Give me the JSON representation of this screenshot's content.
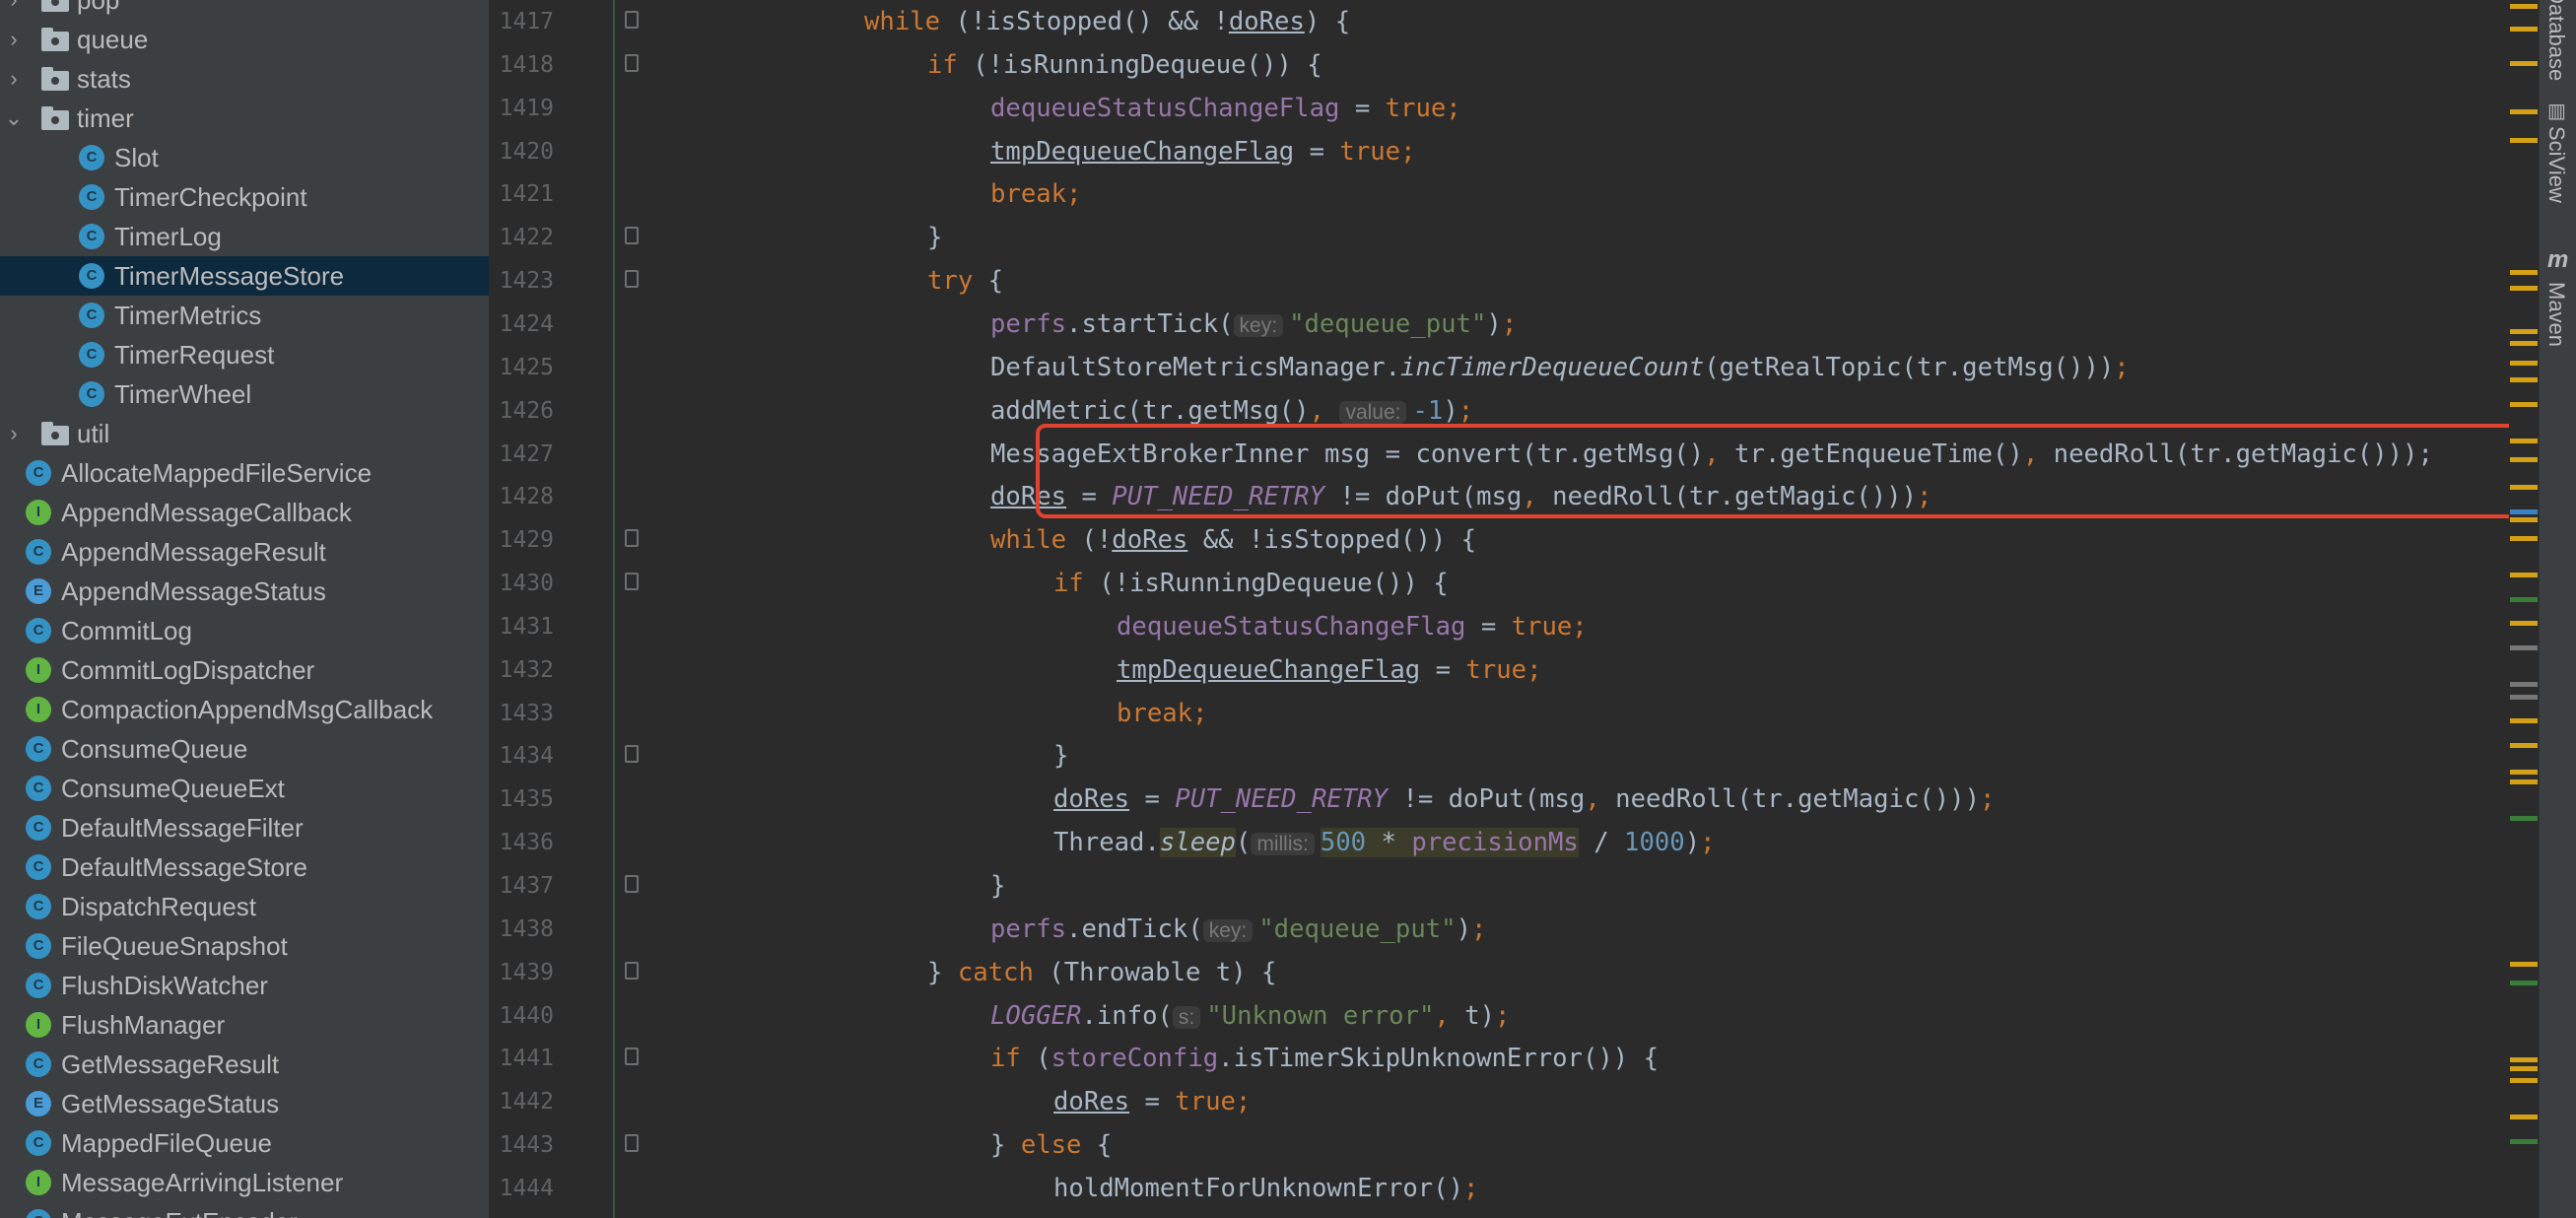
{
  "project_tree": {
    "items": [
      {
        "type": "folder",
        "label": "pop",
        "expanded": false,
        "indent": 1
      },
      {
        "type": "folder",
        "label": "queue",
        "expanded": false,
        "indent": 1
      },
      {
        "type": "folder",
        "label": "stats",
        "expanded": false,
        "indent": 1
      },
      {
        "type": "folder",
        "label": "timer",
        "expanded": true,
        "indent": 1
      },
      {
        "type": "class",
        "label": "Slot",
        "indent": 2
      },
      {
        "type": "class",
        "label": "TimerCheckpoint",
        "indent": 2
      },
      {
        "type": "class",
        "label": "TimerLog",
        "indent": 2
      },
      {
        "type": "class",
        "label": "TimerMessageStore",
        "indent": 2,
        "selected": true
      },
      {
        "type": "class",
        "label": "TimerMetrics",
        "indent": 2
      },
      {
        "type": "class",
        "label": "TimerRequest",
        "indent": 2
      },
      {
        "type": "class",
        "label": "TimerWheel",
        "indent": 2
      },
      {
        "type": "folder",
        "label": "util",
        "expanded": false,
        "indent": 1
      },
      {
        "type": "class",
        "label": "AllocateMappedFileService",
        "indent": 1
      },
      {
        "type": "interface",
        "label": "AppendMessageCallback",
        "indent": 1
      },
      {
        "type": "class",
        "label": "AppendMessageResult",
        "indent": 1
      },
      {
        "type": "enum",
        "label": "AppendMessageStatus",
        "indent": 1
      },
      {
        "type": "class",
        "label": "CommitLog",
        "indent": 1
      },
      {
        "type": "interface",
        "label": "CommitLogDispatcher",
        "indent": 1
      },
      {
        "type": "interface",
        "label": "CompactionAppendMsgCallback",
        "indent": 1
      },
      {
        "type": "class",
        "label": "ConsumeQueue",
        "indent": 1
      },
      {
        "type": "class",
        "label": "ConsumeQueueExt",
        "indent": 1
      },
      {
        "type": "class",
        "label": "DefaultMessageFilter",
        "indent": 1
      },
      {
        "type": "class",
        "label": "DefaultMessageStore",
        "indent": 1
      },
      {
        "type": "class",
        "label": "DispatchRequest",
        "indent": 1
      },
      {
        "type": "class",
        "label": "FileQueueSnapshot",
        "indent": 1
      },
      {
        "type": "class",
        "label": "FlushDiskWatcher",
        "indent": 1
      },
      {
        "type": "interface",
        "label": "FlushManager",
        "indent": 1
      },
      {
        "type": "class",
        "label": "GetMessageResult",
        "indent": 1
      },
      {
        "type": "enum",
        "label": "GetMessageStatus",
        "indent": 1
      },
      {
        "type": "class",
        "label": "MappedFileQueue",
        "indent": 1
      },
      {
        "type": "interface",
        "label": "MessageArrivingListener",
        "indent": 1
      },
      {
        "type": "class",
        "label": "MessageExtEncoder",
        "indent": 1
      }
    ],
    "badge_letters": {
      "class": "C",
      "interface": "I",
      "enum": "E"
    }
  },
  "editor": {
    "lines": [
      {
        "n": "1417",
        "indent": 5,
        "fold": true,
        "tokens": [
          [
            "kw",
            "while"
          ],
          [
            "p",
            " (!isStopped() && !"
          ],
          [
            "u",
            "doRes"
          ],
          [
            "p",
            ") {"
          ]
        ]
      },
      {
        "n": "1418",
        "indent": 6,
        "fold": true,
        "tokens": [
          [
            "kw",
            "if"
          ],
          [
            "p",
            " (!isRunningDequeue()) {"
          ]
        ]
      },
      {
        "n": "1419",
        "indent": 7,
        "tokens": [
          [
            "f",
            "dequeueStatusChangeFlag"
          ],
          [
            "p",
            " = "
          ],
          [
            "kw",
            "true"
          ],
          [
            "kw",
            ";"
          ]
        ]
      },
      {
        "n": "1420",
        "indent": 7,
        "tokens": [
          [
            "u",
            "tmpDequeueChangeFlag"
          ],
          [
            "p",
            " = "
          ],
          [
            "kw",
            "true"
          ],
          [
            "kw",
            ";"
          ]
        ]
      },
      {
        "n": "1421",
        "indent": 7,
        "tokens": [
          [
            "kw",
            "break;"
          ]
        ]
      },
      {
        "n": "1422",
        "indent": 6,
        "fold": true,
        "tokens": [
          [
            "p",
            "}"
          ]
        ]
      },
      {
        "n": "1423",
        "indent": 6,
        "fold": true,
        "tokens": [
          [
            "kw",
            "try"
          ],
          [
            "p",
            " {"
          ]
        ]
      },
      {
        "n": "1424",
        "indent": 7,
        "tokens": [
          [
            "f",
            "perfs"
          ],
          [
            "p",
            ".startTick("
          ],
          [
            "h",
            "key:"
          ],
          [
            "s",
            "\"dequeue_put\""
          ],
          [
            "p",
            ")"
          ],
          [
            "kw",
            ";"
          ]
        ]
      },
      {
        "n": "1425",
        "indent": 7,
        "tokens": [
          [
            "p",
            "DefaultStoreMetricsManager."
          ],
          [
            "st",
            "incTimerDequeueCount"
          ],
          [
            "p",
            "(getRealTopic(tr.getMsg()))"
          ],
          [
            "kw",
            ";"
          ]
        ]
      },
      {
        "n": "1426",
        "indent": 7,
        "tokens": [
          [
            "p",
            "addMetric(tr.getMsg()"
          ],
          [
            "kw",
            ","
          ],
          [
            "p",
            " "
          ],
          [
            "h",
            "value:"
          ],
          [
            "n",
            "-1"
          ],
          [
            "p",
            ")"
          ],
          [
            "kw",
            ";"
          ]
        ]
      },
      {
        "n": "1427",
        "indent": 7,
        "tokens": [
          [
            "p",
            "MessageExtBrokerInner msg = convert(tr.getMsg()"
          ],
          [
            "kw",
            ","
          ],
          [
            "p",
            " tr.getEnqueueTime()"
          ],
          [
            "kw",
            ","
          ],
          [
            "p",
            " needRoll(tr.getMagic()));"
          ]
        ]
      },
      {
        "n": "1428",
        "indent": 7,
        "tokens": [
          [
            "u",
            "doRes"
          ],
          [
            "p",
            " = "
          ],
          [
            "c",
            "PUT_NEED_RETRY"
          ],
          [
            "p",
            " != doPut(msg"
          ],
          [
            "kw",
            ","
          ],
          [
            "p",
            " needRoll(tr.getMagic()))"
          ],
          [
            "kw",
            ";"
          ]
        ]
      },
      {
        "n": "1429",
        "indent": 7,
        "fold": true,
        "tokens": [
          [
            "kw",
            "while"
          ],
          [
            "p",
            " (!"
          ],
          [
            "u",
            "doRes"
          ],
          [
            "p",
            " && !isStopped()) {"
          ]
        ]
      },
      {
        "n": "1430",
        "indent": 8,
        "fold": true,
        "tokens": [
          [
            "kw",
            "if"
          ],
          [
            "p",
            " (!isRunningDequeue()) {"
          ]
        ]
      },
      {
        "n": "1431",
        "indent": 9,
        "tokens": [
          [
            "f",
            "dequeueStatusChangeFlag"
          ],
          [
            "p",
            " = "
          ],
          [
            "kw",
            "true"
          ],
          [
            "kw",
            ";"
          ]
        ]
      },
      {
        "n": "1432",
        "indent": 9,
        "tokens": [
          [
            "u",
            "tmpDequeueChangeFlag"
          ],
          [
            "p",
            " = "
          ],
          [
            "kw",
            "true"
          ],
          [
            "kw",
            ";"
          ]
        ]
      },
      {
        "n": "1433",
        "indent": 9,
        "tokens": [
          [
            "kw",
            "break;"
          ]
        ]
      },
      {
        "n": "1434",
        "indent": 8,
        "fold": true,
        "tokens": [
          [
            "p",
            "}"
          ]
        ]
      },
      {
        "n": "1435",
        "indent": 8,
        "tokens": [
          [
            "u",
            "doRes"
          ],
          [
            "p",
            " = "
          ],
          [
            "c",
            "PUT_NEED_RETRY"
          ],
          [
            "p",
            " != doPut(msg"
          ],
          [
            "kw",
            ","
          ],
          [
            "p",
            " needRoll(tr.getMagic()))"
          ],
          [
            "kw",
            ";"
          ]
        ]
      },
      {
        "n": "1436",
        "indent": 8,
        "tokens": [
          [
            "p",
            "Thread."
          ],
          [
            "sl",
            "sleep"
          ],
          [
            "p",
            "("
          ],
          [
            "h",
            "millis:"
          ],
          [
            "nh",
            "500"
          ],
          [
            "hl",
            " * "
          ],
          [
            "fh",
            "precisionMs"
          ],
          [
            "p",
            " / "
          ],
          [
            "n",
            "1000"
          ],
          [
            "p",
            ")"
          ],
          [
            "kw",
            ";"
          ]
        ]
      },
      {
        "n": "1437",
        "indent": 7,
        "fold": true,
        "tokens": [
          [
            "p",
            "}"
          ]
        ]
      },
      {
        "n": "1438",
        "indent": 7,
        "tokens": [
          [
            "f",
            "perfs"
          ],
          [
            "p",
            ".endTick("
          ],
          [
            "h",
            "key:"
          ],
          [
            "s",
            "\"dequeue_put\""
          ],
          [
            "p",
            ")"
          ],
          [
            "kw",
            ";"
          ]
        ]
      },
      {
        "n": "1439",
        "indent": 6,
        "fold": true,
        "tokens": [
          [
            "p",
            "} "
          ],
          [
            "kw",
            "catch"
          ],
          [
            "p",
            " (Throwable t) {"
          ]
        ]
      },
      {
        "n": "1440",
        "indent": 7,
        "tokens": [
          [
            "c",
            "LOGGER"
          ],
          [
            "p",
            ".info("
          ],
          [
            "h",
            "s:"
          ],
          [
            "s",
            "\"Unknown error\""
          ],
          [
            "kw",
            ","
          ],
          [
            "p",
            " t)"
          ],
          [
            "kw",
            ";"
          ]
        ]
      },
      {
        "n": "1441",
        "indent": 7,
        "fold": true,
        "tokens": [
          [
            "kw",
            "if"
          ],
          [
            "p",
            " ("
          ],
          [
            "f",
            "storeConfig"
          ],
          [
            "p",
            ".isTimerSkipUnknownError()) {"
          ]
        ]
      },
      {
        "n": "1442",
        "indent": 8,
        "tokens": [
          [
            "u",
            "doRes"
          ],
          [
            "p",
            " = "
          ],
          [
            "kw",
            "true"
          ],
          [
            "kw",
            ";"
          ]
        ]
      },
      {
        "n": "1443",
        "indent": 7,
        "fold": true,
        "tokens": [
          [
            "p",
            "} "
          ],
          [
            "kw",
            "else"
          ],
          [
            "p",
            " {"
          ]
        ]
      },
      {
        "n": "1444",
        "indent": 8,
        "tokens": [
          [
            "p",
            "holdMomentForUnknownError()"
          ],
          [
            "kw",
            ";"
          ]
        ]
      }
    ]
  },
  "right_toolbar": {
    "database_label": "Database",
    "sciview_label": "SciView",
    "maven_label": "Maven",
    "maven_icon": "m",
    "sciview_icon": "chart-icon"
  },
  "colors": {
    "keyword": "#cc7832",
    "field": "#9876aa",
    "string": "#6a8759",
    "number": "#6897bb",
    "text": "#a9b7c6",
    "highlight_box": "#e0432f",
    "selection": "#0d293e",
    "class_badge": "#3592c4",
    "interface_badge": "#62b543",
    "enum_badge": "#4a9bd6"
  },
  "scroll_markers": [
    {
      "pos": 0.003,
      "c": "#d4a016"
    },
    {
      "pos": 0.022,
      "c": "#d4a016"
    },
    {
      "pos": 0.05,
      "c": "#d4a016"
    },
    {
      "pos": 0.09,
      "c": "#d4a016"
    },
    {
      "pos": 0.113,
      "c": "#d4a016"
    },
    {
      "pos": 0.222,
      "c": "#d4a016"
    },
    {
      "pos": 0.235,
      "c": "#d4a016"
    },
    {
      "pos": 0.27,
      "c": "#d4a016"
    },
    {
      "pos": 0.28,
      "c": "#d4a016"
    },
    {
      "pos": 0.296,
      "c": "#d4a016"
    },
    {
      "pos": 0.31,
      "c": "#d4a016"
    },
    {
      "pos": 0.33,
      "c": "#d4a016"
    },
    {
      "pos": 0.36,
      "c": "#d4a016"
    },
    {
      "pos": 0.375,
      "c": "#d4a016"
    },
    {
      "pos": 0.398,
      "c": "#d4a016"
    },
    {
      "pos": 0.418,
      "c": "#3a83c4"
    },
    {
      "pos": 0.425,
      "c": "#d4a016"
    },
    {
      "pos": 0.44,
      "c": "#d4a016"
    },
    {
      "pos": 0.47,
      "c": "#d4a016"
    },
    {
      "pos": 0.49,
      "c": "#3a7d3a"
    },
    {
      "pos": 0.51,
      "c": "#d4a016"
    },
    {
      "pos": 0.53,
      "c": "#777777"
    },
    {
      "pos": 0.56,
      "c": "#777777"
    },
    {
      "pos": 0.57,
      "c": "#777777"
    },
    {
      "pos": 0.59,
      "c": "#d4a016"
    },
    {
      "pos": 0.61,
      "c": "#d4a016"
    },
    {
      "pos": 0.632,
      "c": "#d4a016"
    },
    {
      "pos": 0.64,
      "c": "#d4a016"
    },
    {
      "pos": 0.67,
      "c": "#3a7d3a"
    },
    {
      "pos": 0.79,
      "c": "#d4a016"
    },
    {
      "pos": 0.805,
      "c": "#3a7d3a"
    },
    {
      "pos": 0.868,
      "c": "#d4a016"
    },
    {
      "pos": 0.875,
      "c": "#d4a016"
    },
    {
      "pos": 0.885,
      "c": "#d4a016"
    },
    {
      "pos": 0.915,
      "c": "#d4a016"
    },
    {
      "pos": 0.935,
      "c": "#3a7d3a"
    }
  ]
}
